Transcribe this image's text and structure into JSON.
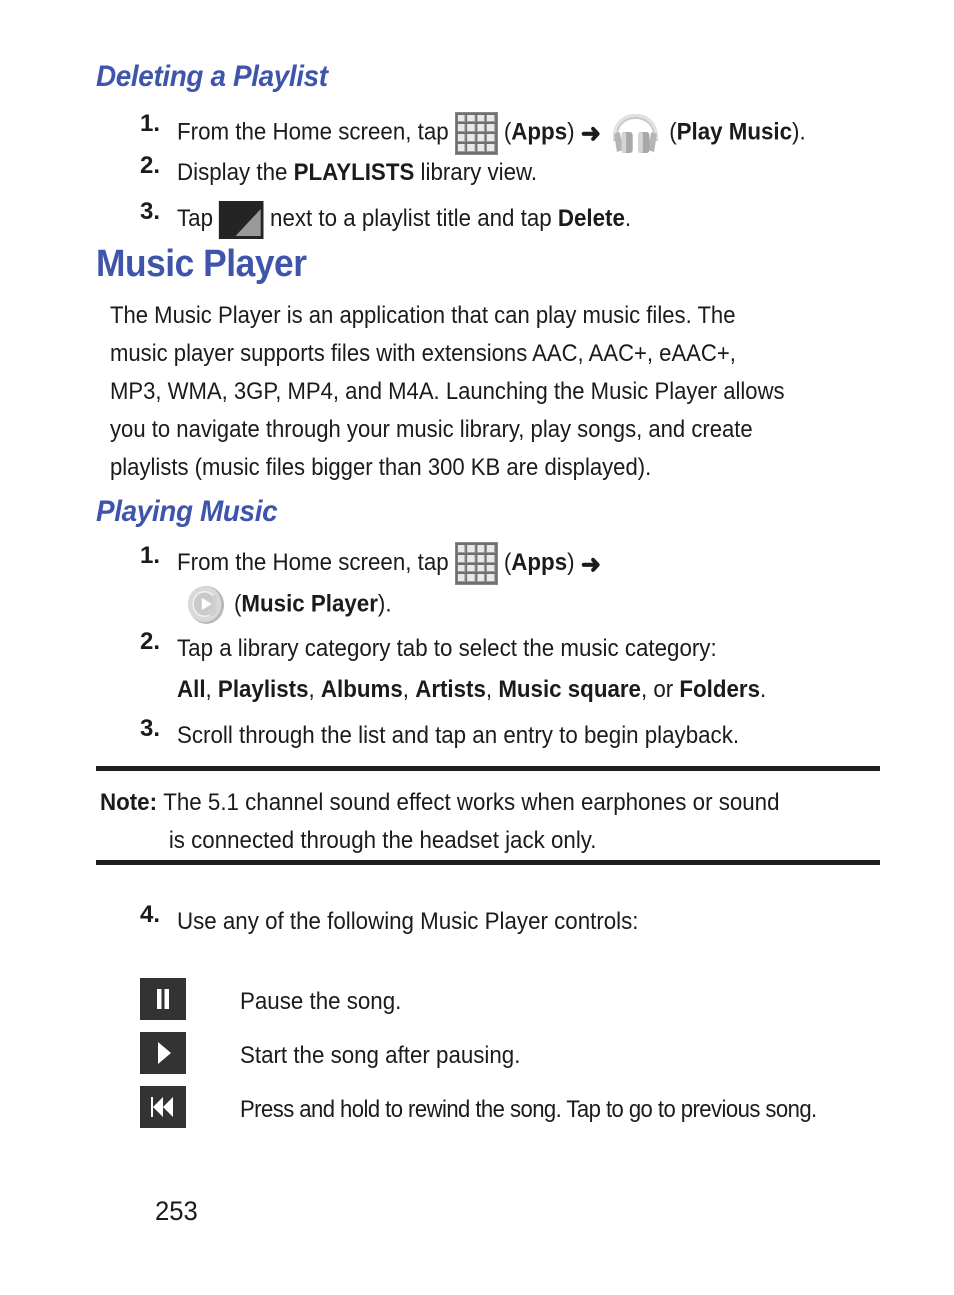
{
  "document": {
    "page_number": "253",
    "heading_color": "#3f55ab",
    "text_color": "#1b1b1b",
    "icon_dark": "#333333",
    "icon_gray": "#6f6f6f"
  },
  "sections": {
    "deleting_playlist": {
      "heading": "Deleting a Playlist",
      "steps": [
        {
          "num": "1.",
          "part1": "From the Home screen, tap",
          "icon1": "apps-grid-icon",
          "label1_open": "(",
          "label1": "Apps",
          "label1_close": ")",
          "arrow": "➜",
          "icon2": "headphones-icon",
          "label2_open": "(",
          "label2": "Play Music",
          "label2_close": ")."
        },
        {
          "num": "2.",
          "pre": "Display the ",
          "bold": "PLAYLISTS",
          "post": " library view."
        },
        {
          "num": "3.",
          "pre": "Tap",
          "icon": "corner-triangle-icon",
          "mid": "next to a playlist title and tap ",
          "bold": "Delete",
          "post": "."
        }
      ]
    },
    "music_player": {
      "heading": "Music Player",
      "paragraph_lines": [
        "The Music Player is an application that can play music files. The",
        "music player supports files with extensions AAC, AAC+, eAAC+,",
        "MP3, WMA, 3GP, MP4, and M4A. Launching the Music Player allows",
        "you to navigate through your music library, play songs, and create",
        "playlists (music files bigger than 300 KB are displayed)."
      ]
    },
    "playing_music": {
      "heading": "Playing Music",
      "steps": [
        {
          "num": "1.",
          "part1": "From the Home screen, tap",
          "icon1": "apps-grid-icon",
          "label1_open": "(",
          "label1": "Apps",
          "label1_close": ")",
          "arrow": "➜",
          "icon2": "music-player-icon",
          "label2_open": "(",
          "label2": "Music Player",
          "label2_close": ")."
        },
        {
          "num": "2.",
          "line1": "Tap a library category tab to select the music category:",
          "categories_prefix": "",
          "categories": [
            "All",
            "Playlists",
            "Albums",
            "Artists",
            "Music square"
          ],
          "categories_conjunction": ", or ",
          "categories_last": "Folders",
          "categories_suffix": "."
        },
        {
          "num": "3.",
          "line1": "Scroll through the list and tap an entry to begin playback."
        }
      ],
      "note": {
        "label": "Note:",
        "line1": "The 5.1 channel sound effect works when earphones or sound",
        "line2": "is connected through the headset jack only."
      },
      "step4": {
        "num": "4.",
        "text": "Use any of the following Music Player controls:"
      },
      "controls": [
        {
          "icon": "pause-icon",
          "description": "Pause the song."
        },
        {
          "icon": "play-icon",
          "description": "Start the song after pausing."
        },
        {
          "icon": "rewind-icon",
          "description": "Press and hold to rewind the song. Tap to go to previous song."
        }
      ]
    }
  }
}
